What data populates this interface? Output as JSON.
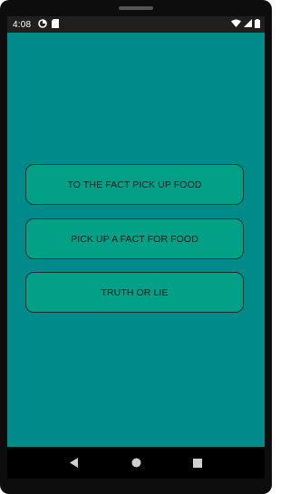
{
  "status_bar": {
    "time": "4:08",
    "notification_icons": [
      "data-saver-icon",
      "sd-card-icon"
    ],
    "right_icons": [
      "wifi-icon",
      "signal-icon",
      "battery-icon"
    ]
  },
  "main": {
    "buttons": [
      {
        "label": "TO THE FACT PICK UP FOOD"
      },
      {
        "label": "PICK UP A FACT FOR FOOD"
      },
      {
        "label": "TRUTH OR LIE"
      }
    ]
  },
  "colors": {
    "background": "#008b8a",
    "button_fill": "#01a087",
    "button_border": "#1c2f2c"
  },
  "nav_bar": {
    "icons": [
      "back-icon",
      "home-icon",
      "recents-icon"
    ]
  }
}
